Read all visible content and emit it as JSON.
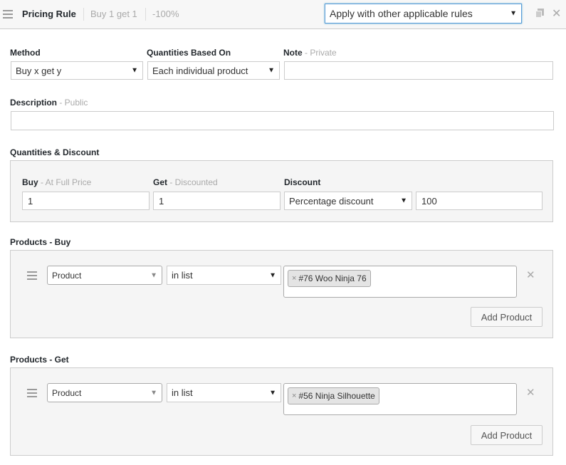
{
  "header": {
    "title": "Pricing Rule",
    "summary_1": "Buy 1 get 1",
    "summary_2": "-100%",
    "exclusivity_value": "Apply with other applicable rules"
  },
  "method": {
    "label": "Method",
    "value": "Buy x get y"
  },
  "quantities_based_on": {
    "label": "Quantities Based On",
    "value": "Each individual product"
  },
  "note": {
    "label": "Note",
    "sub": " - Private",
    "value": ""
  },
  "description": {
    "label": "Description",
    "sub": " - Public",
    "value": ""
  },
  "quantities_discount": {
    "label": "Quantities & Discount",
    "buy_label": "Buy",
    "buy_sub": " - At Full Price",
    "buy_value": "1",
    "get_label": "Get",
    "get_sub": " - Discounted",
    "get_value": "1",
    "discount_label": "Discount",
    "discount_type": "Percentage discount",
    "discount_value": "100"
  },
  "products_buy": {
    "label": "Products - Buy",
    "type": "Product",
    "condition": "in list",
    "tag_remove": "×",
    "tag": "#76 Woo Ninja 76",
    "add_label": "Add Product"
  },
  "products_get": {
    "label": "Products - Get",
    "type": "Product",
    "condition": "in list",
    "tag_remove": "×",
    "tag": "#56 Ninja Silhouette",
    "add_label": "Add Product"
  },
  "icons": {
    "hamburger": "hamburger-icon",
    "duplicate": "duplicate-icon",
    "close": "close-icon",
    "dropdown": "chevron-down-icon",
    "drag": "drag-handle-icon",
    "remove": "remove-icon"
  }
}
